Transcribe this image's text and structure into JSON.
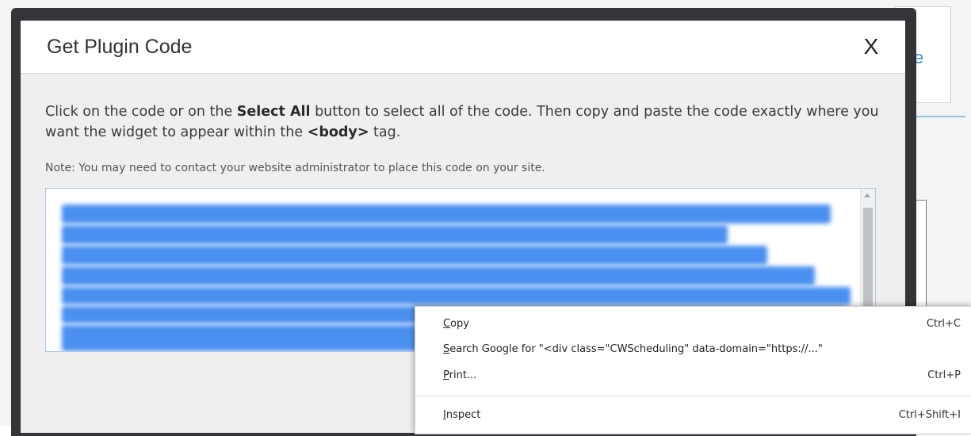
{
  "background": {
    "link_text": "le"
  },
  "dialog": {
    "title": "Get Plugin Code",
    "close_label": "X",
    "instruction_part1": "Click on the code or on the ",
    "instruction_bold1": "Select All",
    "instruction_part2": " button to select all of the code. Then copy and paste the code exactly where you want the widget to appear within the ",
    "instruction_bold2": "<body>",
    "instruction_part3": " tag.",
    "note": "Note: You may need to contact your website administrator to place this code on your site."
  },
  "context_menu": {
    "items": [
      {
        "mnemonic": "C",
        "rest": "opy",
        "shortcut": "Ctrl+C"
      },
      {
        "mnemonic": "S",
        "rest": "earch Google for \"<div class=\"CWScheduling\" data-domain=\"https://...\"",
        "shortcut": ""
      },
      {
        "mnemonic": "P",
        "rest": "rint...",
        "shortcut": "Ctrl+P"
      },
      {
        "mnemonic": "I",
        "rest": "nspect",
        "shortcut": "Ctrl+Shift+I"
      }
    ]
  },
  "colors": {
    "selection": "#4a90f0",
    "modal_frame": "#333538",
    "modal_body": "#efefef",
    "accent_link": "#3c8fd8"
  }
}
